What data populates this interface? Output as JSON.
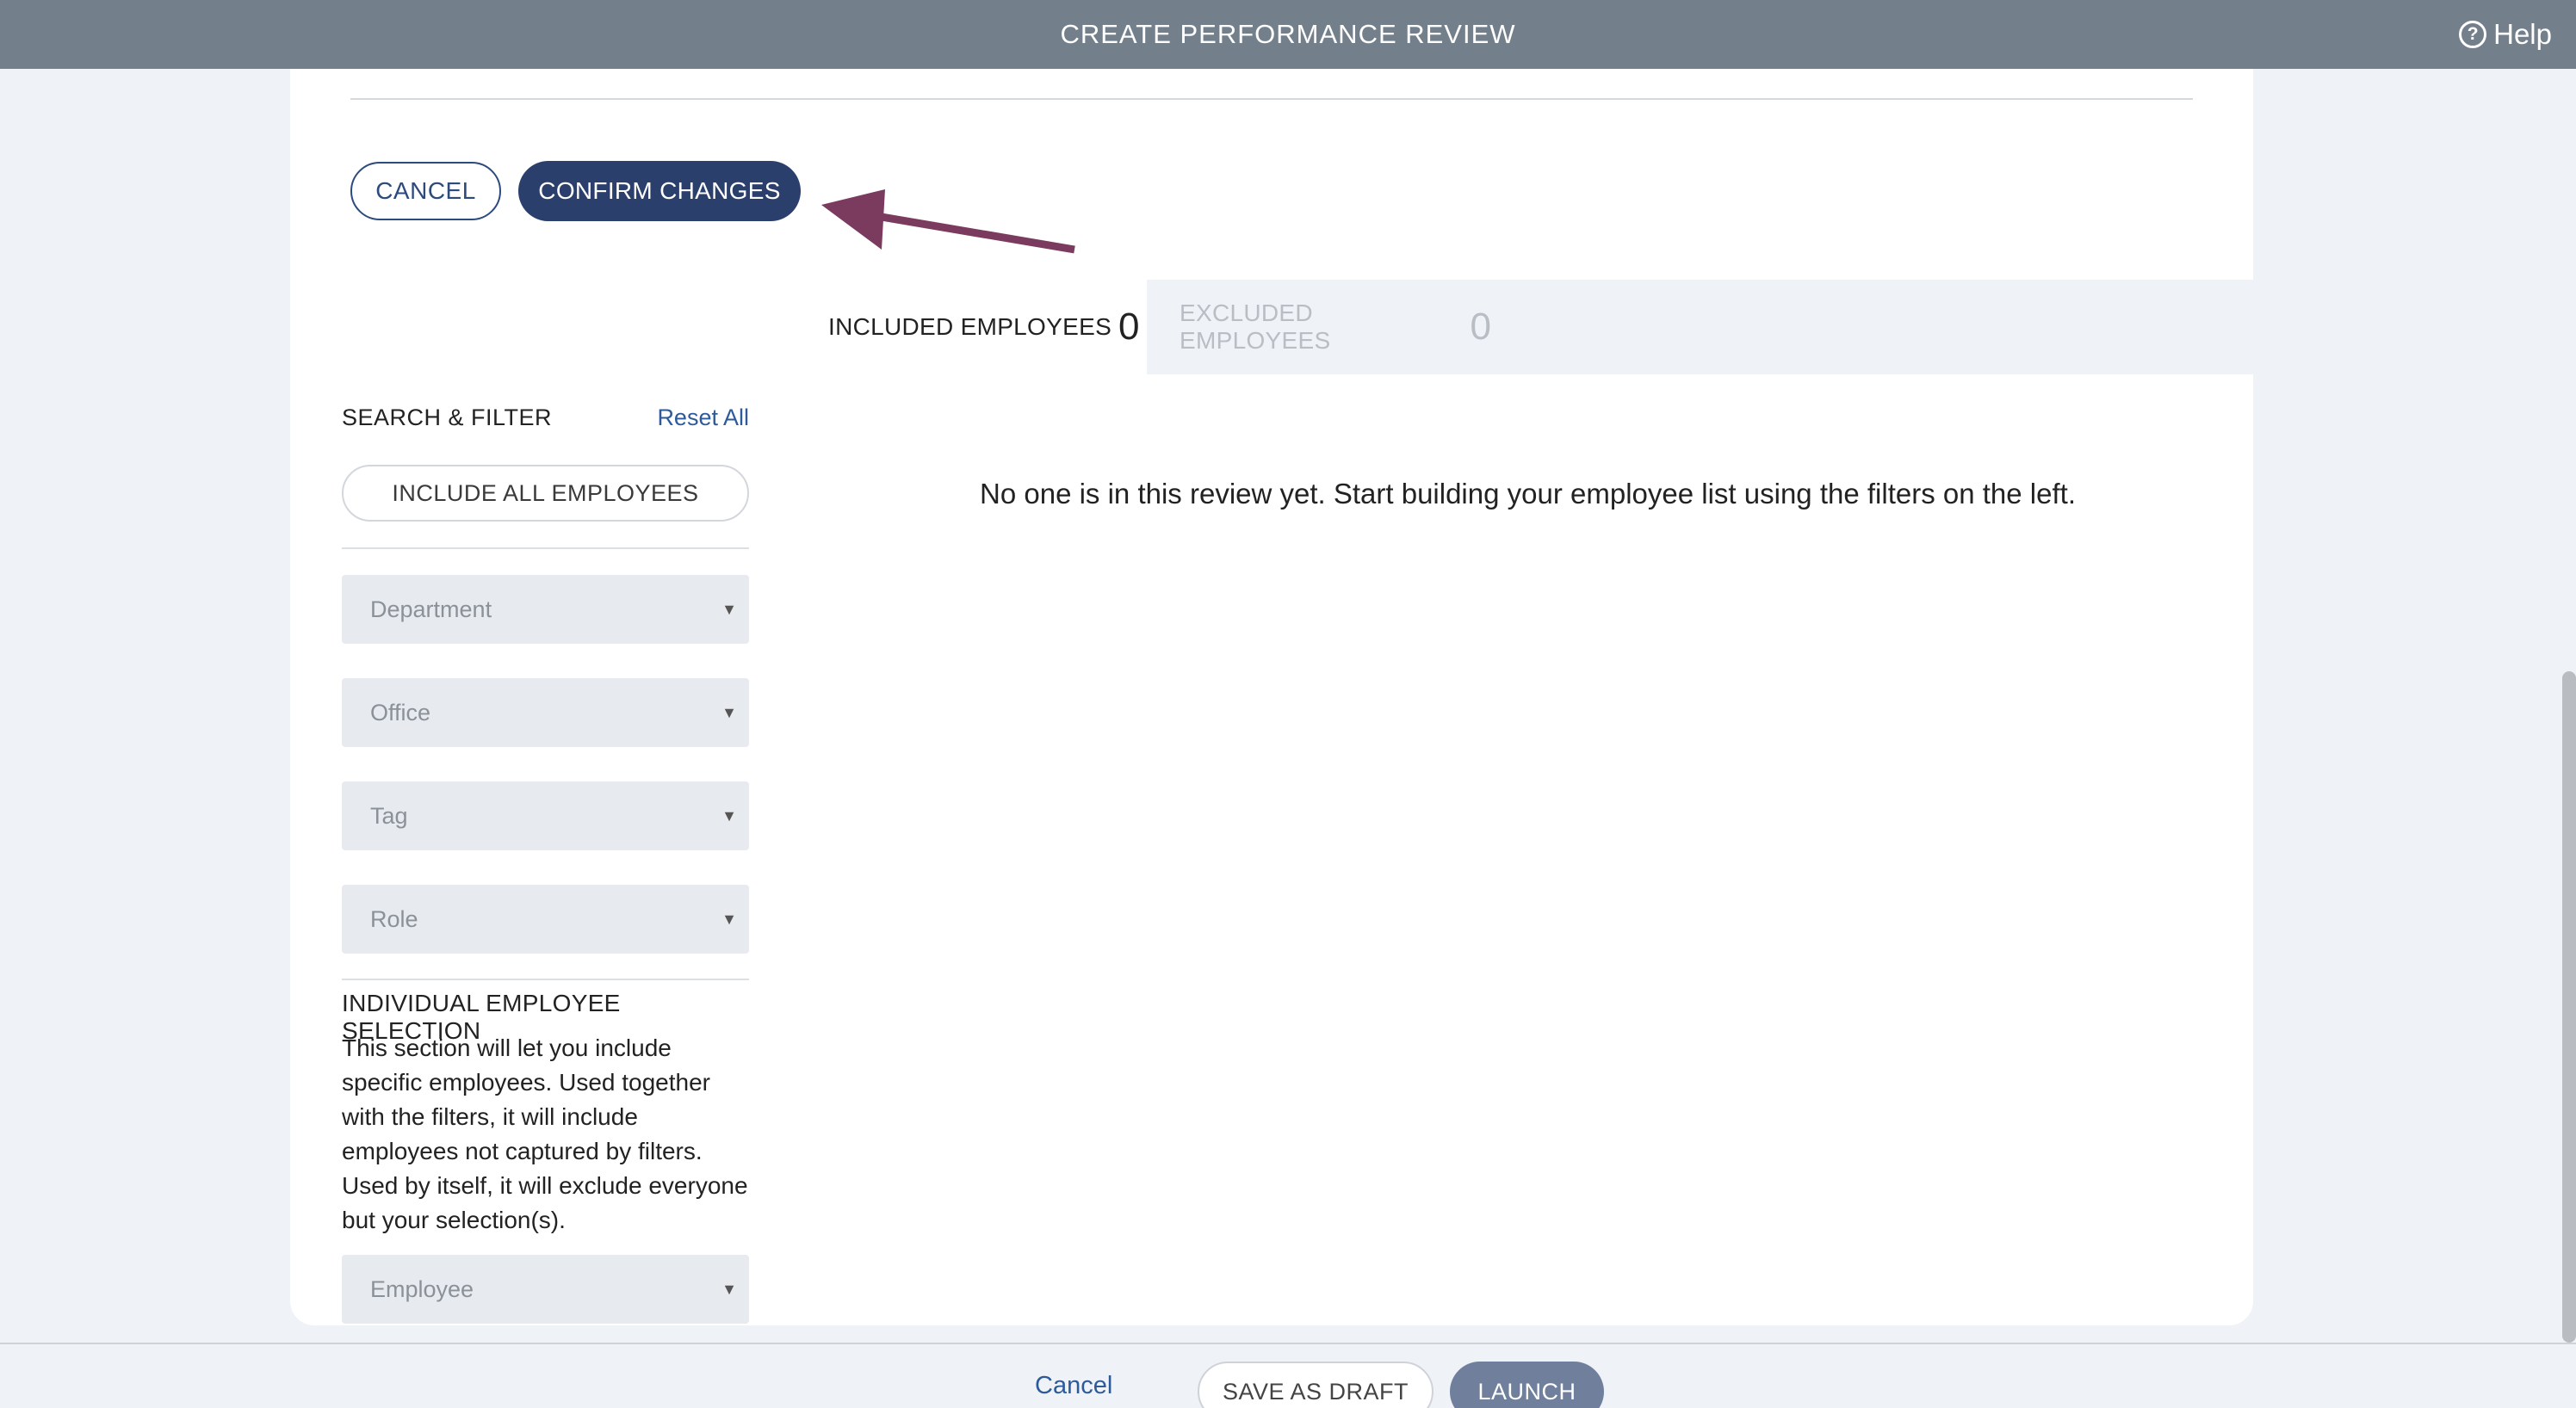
{
  "header": {
    "title": "CREATE PERFORMANCE REVIEW",
    "help_label": "Help",
    "help_icon": "question-circle-icon",
    "background": "#73808b"
  },
  "actions": {
    "cancel_label": "CANCEL",
    "confirm_label": "CONFIRM CHANGES"
  },
  "annotation": {
    "arrow_color": "#7a3b5e"
  },
  "filters": {
    "title": "SEARCH & FILTER",
    "reset_label": "Reset All",
    "include_all_label": "INCLUDE ALL EMPLOYEES",
    "selects": [
      {
        "placeholder": "Department"
      },
      {
        "placeholder": "Office"
      },
      {
        "placeholder": "Tag"
      },
      {
        "placeholder": "Role"
      }
    ],
    "individual": {
      "title": "INDIVIDUAL EMPLOYEE SELECTION",
      "description": "This section will let you include specific employees. Used together with the filters, it will include employees not captured by filters. Used by itself, it will exclude everyone but your selection(s).",
      "select_placeholder": "Employee"
    }
  },
  "tabs": {
    "included": {
      "label": "INCLUDED EMPLOYEES",
      "count": "0"
    },
    "excluded": {
      "label": "EXCLUDED EMPLOYEES",
      "count": "0"
    }
  },
  "main": {
    "empty_message": "No one is in this review yet. Start building your employee list using the filters on the left."
  },
  "footer": {
    "cancel_label": "Cancel",
    "save_draft_label": "SAVE AS DRAFT",
    "launch_label": "LAUNCH"
  }
}
